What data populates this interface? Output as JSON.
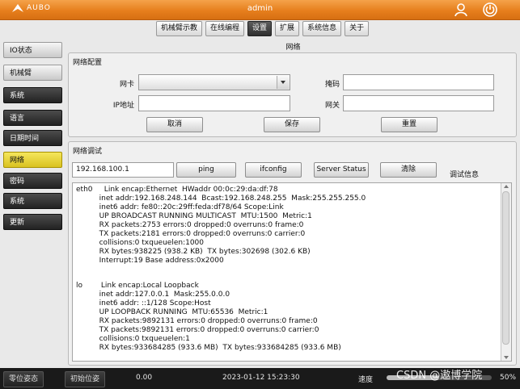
{
  "app": {
    "logo_text": "AUBO",
    "user": "admin"
  },
  "top_tabs": [
    {
      "label": "机械臂示教"
    },
    {
      "label": "在线编程"
    },
    {
      "label": "设置"
    },
    {
      "label": "扩展"
    },
    {
      "label": "系统信息"
    },
    {
      "label": "关于"
    }
  ],
  "active_top_tab": "设置",
  "page_subtitle": "网络",
  "left_nav": [
    {
      "label": "IO状态"
    },
    {
      "label": "机械臂"
    },
    {
      "label": "系统"
    },
    {
      "label": "语言"
    },
    {
      "label": "日期时间"
    },
    {
      "label": "网络"
    },
    {
      "label": "密码"
    },
    {
      "label": "系统"
    },
    {
      "label": "更新"
    }
  ],
  "network_config": {
    "title": "网络配置",
    "nic_label": "网卡",
    "nic_value": "",
    "mask_label": "掩码",
    "mask_value": "",
    "ip_label": "IP地址",
    "ip_value": "",
    "gateway_label": "网关",
    "gateway_value": "",
    "cancel_label": "取消",
    "save_label": "保存",
    "reset_label": "重置"
  },
  "network_debug": {
    "title": "网络调试",
    "address_value": "192.168.100.1",
    "ping_label": "ping",
    "ifconfig_label": "ifconfig",
    "server_status_label": "Server Status",
    "clear_label": "清除",
    "debug_info_label": "调试信息",
    "output_lines": [
      "eth0     Link encap:Ethernet  HWaddr 00:0c:29:da:df:78",
      "          inet addr:192.168.248.144  Bcast:192.168.248.255  Mask:255.255.255.0",
      "          inet6 addr: fe80::20c:29ff:feda:df78/64 Scope:Link",
      "          UP BROADCAST RUNNING MULTICAST  MTU:1500  Metric:1",
      "          RX packets:2753 errors:0 dropped:0 overruns:0 frame:0",
      "          TX packets:2181 errors:0 dropped:0 overruns:0 carrier:0",
      "          collisions:0 txqueuelen:1000",
      "          RX bytes:938225 (938.2 KB)  TX bytes:302698 (302.6 KB)",
      "          Interrupt:19 Base address:0x2000",
      "",
      "lo        Link encap:Local Loopback",
      "          inet addr:127.0.0.1  Mask:255.0.0.0",
      "          inet6 addr: ::1/128 Scope:Host",
      "          UP LOOPBACK RUNNING  MTU:65536  Metric:1",
      "          RX packets:9892131 errors:0 dropped:0 overruns:0 frame:0",
      "          TX packets:9892131 errors:0 dropped:0 overruns:0 carrier:0",
      "          collisions:0 txqueuelen:1",
      "          RX bytes:933684285 (933.6 MB)  TX bytes:933684285 (933.6 MB)"
    ]
  },
  "bottom_bar": {
    "zero_pose_label": "零位姿态",
    "init_pose_label": "初始位姿",
    "value": "0.00",
    "datetime": "2023-01-12 15:23:30",
    "speed_label": "速度",
    "speed_percent": "50%",
    "speed_fraction": 0.5
  },
  "watermark": "CSDN @遨博学院"
}
